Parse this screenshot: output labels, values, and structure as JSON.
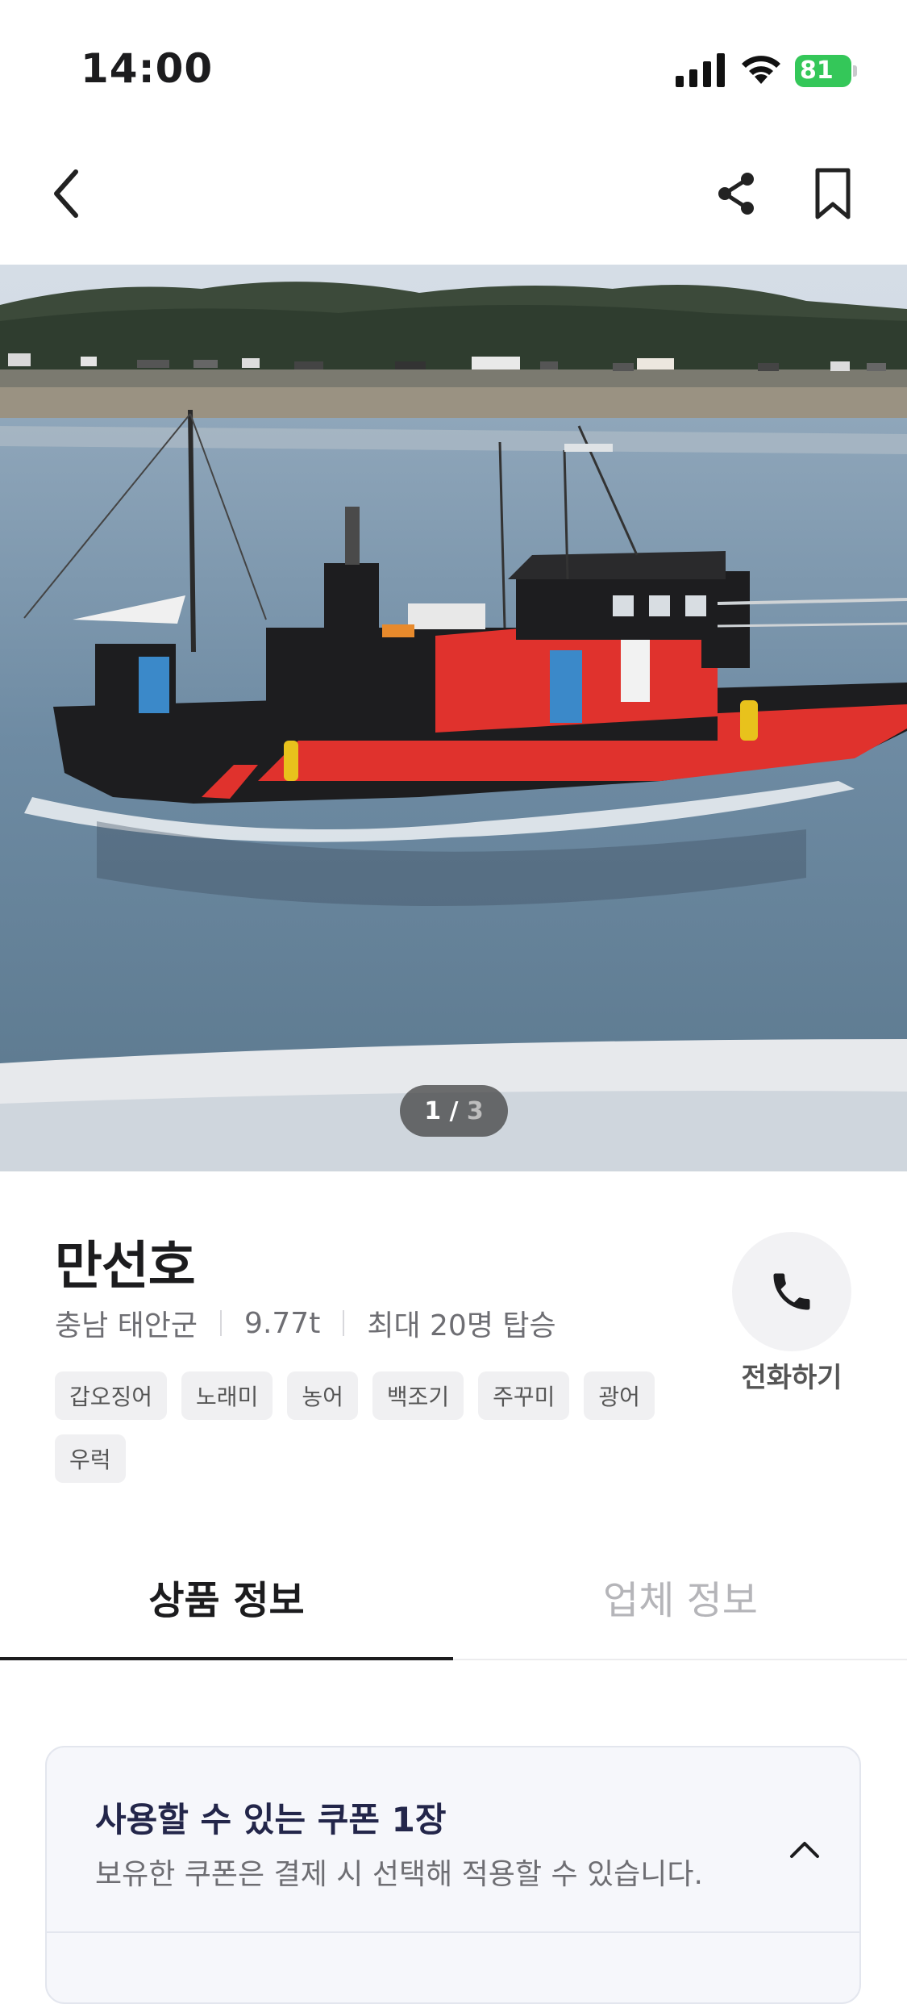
{
  "status_bar": {
    "time": "14:00",
    "battery": "81"
  },
  "nav": {
    "back_icon": "chevron-left-icon",
    "share_icon": "share-icon",
    "bookmark_icon": "bookmark-icon"
  },
  "hero": {
    "page_current": "1",
    "page_separator": " / ",
    "page_total": "3"
  },
  "product": {
    "name": "만선호",
    "region": "충남 태안군",
    "tonnage": "9.77t",
    "capacity": "최대 20명 탑승",
    "tags": [
      "갑오징어",
      "노래미",
      "농어",
      "백조기",
      "주꾸미",
      "광어",
      "우럭"
    ]
  },
  "call": {
    "label": "전화하기",
    "icon": "phone-icon"
  },
  "tabs": [
    {
      "label": "상품 정보",
      "active": true
    },
    {
      "label": "업체 정보",
      "active": false
    }
  ],
  "coupon": {
    "title": "사용할 수 있는 쿠폰 1장",
    "subtitle": "보유한 쿠폰은 결제 시 선택해 적용할 수 있습니다.",
    "toggle_icon": "chevron-up-icon"
  },
  "colors": {
    "accent_green": "#34c759",
    "text_primary": "#1c1c1e",
    "text_secondary": "#6e6e73",
    "coupon_title": "#23264a"
  }
}
